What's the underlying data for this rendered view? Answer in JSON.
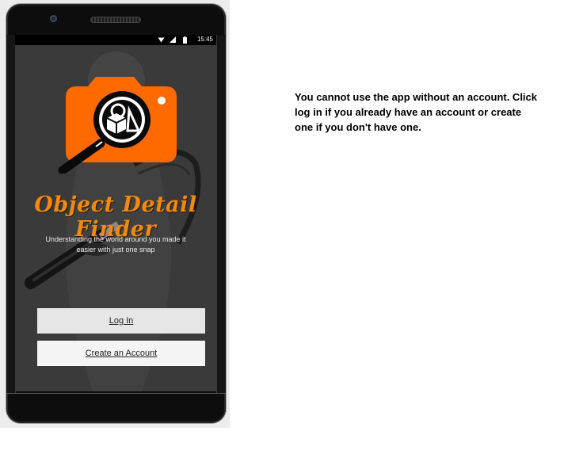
{
  "status_bar": {
    "time": "15:45",
    "icons": [
      "wifi-icon",
      "signal-icon",
      "battery-icon"
    ]
  },
  "app": {
    "title": "Object Detail Finder",
    "tagline": "Understanding the world around you made it easier with just one snap",
    "logo_icon": "camera-magnifier-logo",
    "colors": {
      "brand_orange": "#ff6a00",
      "title_orange": "#f08a10",
      "screen_background": "#3a3a3a"
    }
  },
  "buttons": {
    "login_label": "Log In",
    "create_label": "Create an Account"
  },
  "instruction": {
    "text": "You cannot use the app without an account. Click log in if you already have an account or create one if you don't have one."
  }
}
